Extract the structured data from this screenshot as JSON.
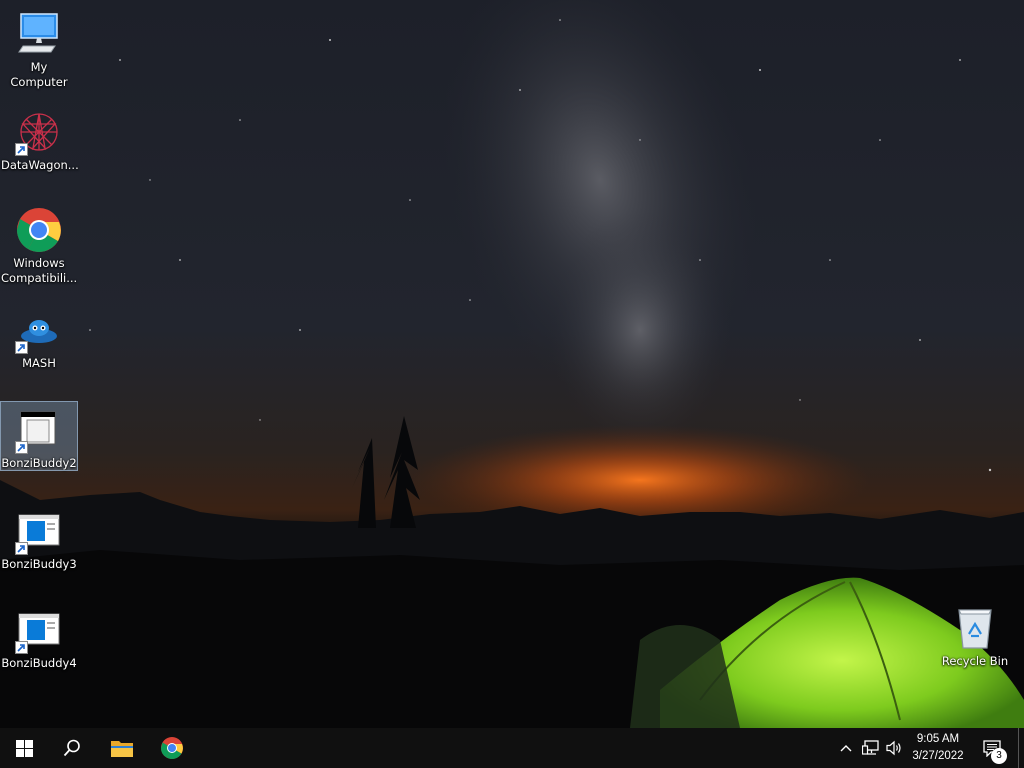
{
  "desktop": {
    "icons": [
      {
        "label": "My Computer",
        "icon": "computer-icon",
        "shortcut": false
      },
      {
        "label": "DataWagon...",
        "icon": "datawagon-icon",
        "shortcut": true
      },
      {
        "label": "Windows\nCompatibili...",
        "icon": "chrome-icon",
        "shortcut": false
      },
      {
        "label": "MASH",
        "icon": "mash-icon",
        "shortcut": true
      },
      {
        "label": "BonziBuddy2",
        "icon": "window-app-icon",
        "shortcut": true,
        "selected": true
      },
      {
        "label": "BonziBuddy3",
        "icon": "window-app-icon",
        "shortcut": true
      },
      {
        "label": "BonziBuddy4",
        "icon": "window-app-icon",
        "shortcut": true
      },
      {
        "label": "Recycle Bin",
        "icon": "recycle-bin-icon",
        "shortcut": false
      }
    ]
  },
  "taskbar": {
    "pinned": [
      "start-icon",
      "search-icon",
      "file-explorer-icon",
      "chrome-icon"
    ],
    "tray": [
      "chevron-up-icon",
      "network-icon",
      "volume-icon"
    ],
    "clock": {
      "time": "9:05 AM",
      "date": "3/27/2022"
    },
    "notifications": {
      "count": "3",
      "icon": "action-center-icon"
    }
  },
  "colors": {
    "taskbar": "#101010",
    "tent": "#7ed321",
    "horizon_glow": "#ff6a1a",
    "start_blue": "#ffffff"
  }
}
